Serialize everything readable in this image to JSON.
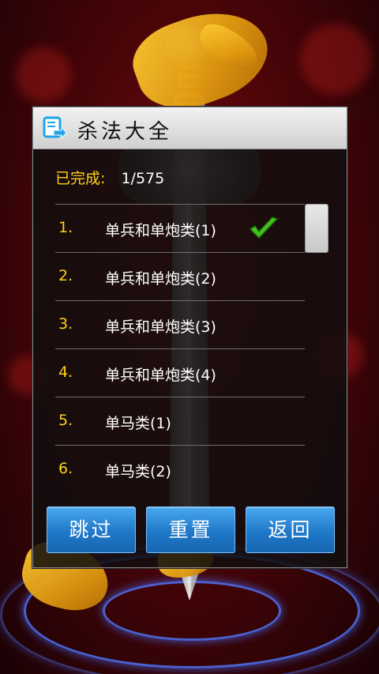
{
  "dialog": {
    "title": "杀法大全",
    "progress_label": "已完成:",
    "progress_value": "1/575"
  },
  "items": [
    {
      "num": "1.",
      "label": "单兵和单炮类(1)",
      "completed": true
    },
    {
      "num": "2.",
      "label": "单兵和单炮类(2)",
      "completed": false
    },
    {
      "num": "3.",
      "label": "单兵和单炮类(3)",
      "completed": false
    },
    {
      "num": "4.",
      "label": "单兵和单炮类(4)",
      "completed": false
    },
    {
      "num": "5.",
      "label": "单马类(1)",
      "completed": false
    },
    {
      "num": "6.",
      "label": "单马类(2)",
      "completed": false
    }
  ],
  "buttons": {
    "skip": "跳过",
    "reset": "重置",
    "back": "返回"
  },
  "colors": {
    "accent_yellow": "#ffd21a",
    "button_blue": "#1f78c8",
    "check_green": "#46c21e"
  },
  "icons": {
    "title": "puzzle-export-icon",
    "completed": "check-icon"
  }
}
